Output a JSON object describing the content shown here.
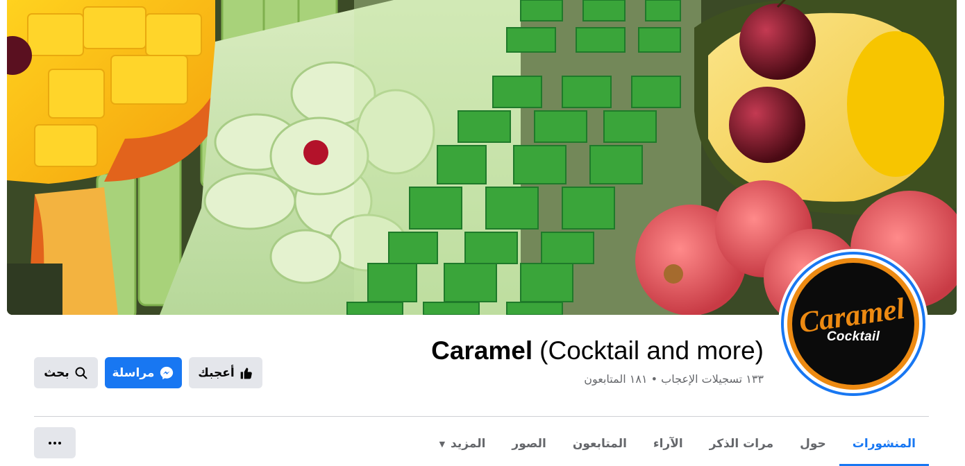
{
  "cover": {
    "alt": "Fruit platter",
    "icon": "cover-photo"
  },
  "avatar": {
    "logo_text": "Caramel",
    "logo_subtext": "Cocktail",
    "colors": {
      "ring": "#1877f2",
      "logo_orange": "#ed8a12",
      "logo_black": "#0b0b0b"
    }
  },
  "page": {
    "name": "Caramel",
    "subtitle": "(Cocktail and more)",
    "stats": "١٣٣ تسجيلات الإعجاب • ١٨١ المتابعون"
  },
  "actions": {
    "like_label": "أعجبك",
    "like_icon": "thumbs-up-icon",
    "message_label": "مراسلة",
    "message_icon": "messenger-icon",
    "search_label": "بحث",
    "search_icon": "search-icon"
  },
  "tabs": [
    {
      "label": "المنشورات",
      "active": true
    },
    {
      "label": "حول",
      "active": false
    },
    {
      "label": "مرات الذكر",
      "active": false
    },
    {
      "label": "الآراء",
      "active": false
    },
    {
      "label": "المتابعون",
      "active": false
    },
    {
      "label": "الصور",
      "active": false
    },
    {
      "label": "المزيد",
      "active": false,
      "caret": "▼"
    }
  ],
  "more_button_icon": "ellipsis-icon",
  "colors": {
    "accent": "#1877f2",
    "button_gray": "#e4e6eb",
    "secondary_text": "#65676b"
  }
}
